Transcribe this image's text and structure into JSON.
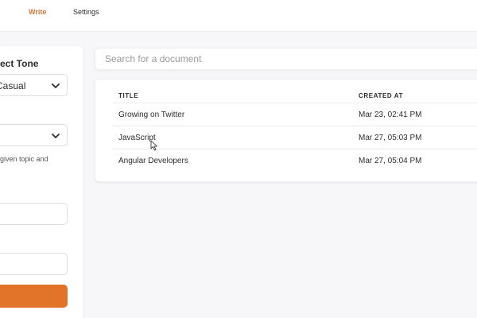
{
  "nav": {
    "write_label": "Write",
    "settings_label": "Settings",
    "accent_color": "#c8763a"
  },
  "sidebar": {
    "tone_heading": "ect Tone",
    "tone_value": "Casual",
    "second_select_value": "",
    "hint_text": "given topic and",
    "button_color": "#e2742a"
  },
  "search": {
    "placeholder": "Search for a document"
  },
  "table": {
    "headers": {
      "title": "TITLE",
      "created": "CREATED AT"
    },
    "rows": [
      {
        "title": "Growing on Twitter",
        "created": "Mar 23, 02:41 PM"
      },
      {
        "title": "JavaScript",
        "created": "Mar 27, 05:03 PM"
      },
      {
        "title": "Angular Developers",
        "created": "Mar 27, 05:04 PM"
      }
    ]
  }
}
